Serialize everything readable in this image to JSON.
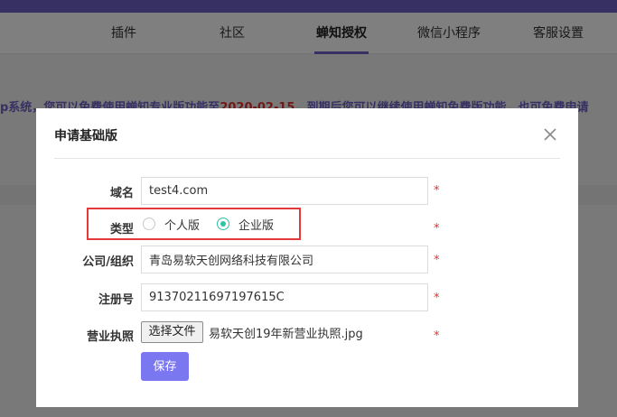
{
  "nav": {
    "items": [
      "插件",
      "社区",
      "蝉知授权",
      "微信小程序",
      "客服设置"
    ],
    "active_index": 2
  },
  "notice": {
    "text_before": "p系统，您可以免费使用蝉知专业版功能至",
    "date": "2020-02-15",
    "text_after": "，到期后您可以继续使用蝉知免费版功能，也可免费申请"
  },
  "dialog": {
    "title": "申请基础版",
    "fields": {
      "domain": {
        "label": "域名",
        "value": "test4.com",
        "required": "*"
      },
      "type": {
        "label": "类型",
        "options": [
          "个人版",
          "企业版"
        ],
        "selected": "企业版",
        "required": "*"
      },
      "company": {
        "label": "公司/组织",
        "value": "青岛易软天创网络科技有限公司",
        "required": "*"
      },
      "reg_no": {
        "label": "注册号",
        "value": "91370211697197615C",
        "required": "*"
      },
      "license": {
        "label": "营业执照",
        "button": "选择文件",
        "file_name": "易软天创19年新营业执照.jpg",
        "required": "*"
      }
    },
    "save_label": "保存"
  },
  "colors": {
    "brand": "#6f63c7",
    "accent_button": "#7b77f0",
    "required": "#e0342f",
    "radio_checked": "#2fc4a6",
    "highlight": "#e23a3a"
  }
}
